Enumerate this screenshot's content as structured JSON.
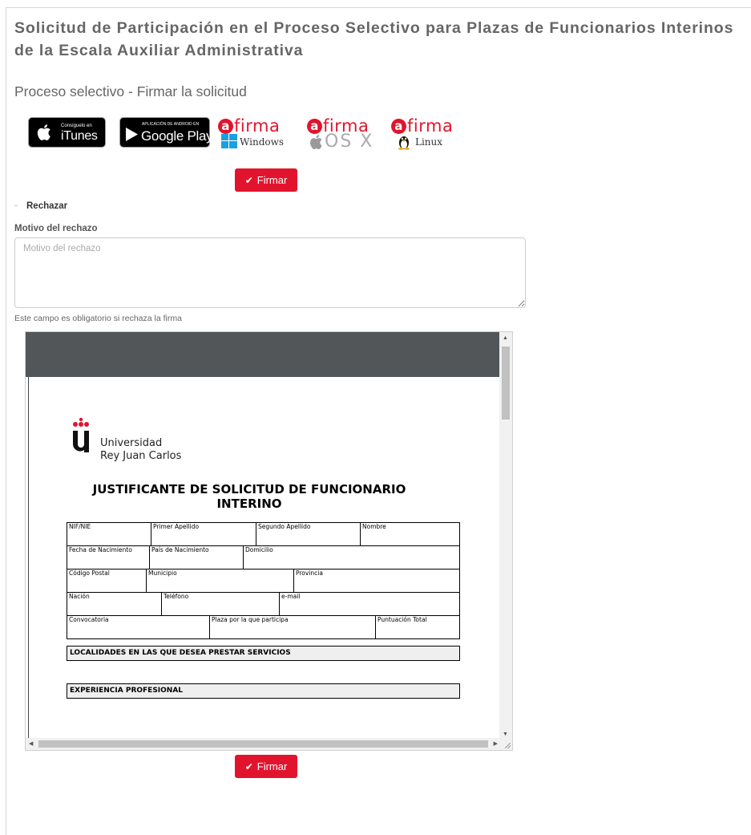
{
  "page": {
    "title": "Solicitud de Participación en el Proceso Selectivo para Plazas de Funcionarios Interinos de la Escala Auxiliar Administrativa",
    "subtitle": "Proceso selectivo - Firmar la solicitud"
  },
  "badges": {
    "itunes": {
      "small": "Consíguelo en",
      "big": "iTunes",
      "icon": "apple-icon"
    },
    "google_play": {
      "small": "APLICACIÓN DE ANDROID EN",
      "big": "Google Play",
      "icon": "play-triangle-icon"
    },
    "afirma": [
      {
        "brand": "firma",
        "platform": "Windows",
        "icon": "windows-icon"
      },
      {
        "brand": "firma",
        "platform": "OS X",
        "icon": "apple-icon"
      },
      {
        "brand": "firma",
        "platform": "Linux",
        "icon": "tux-icon"
      }
    ]
  },
  "actions": {
    "firmar_label": "Firmar",
    "rechazar_label": "Rechazar"
  },
  "reject_form": {
    "label": "Motivo del rechazo",
    "placeholder": "Motivo del rechazo",
    "value": "",
    "hint": "Este campo es obligatorio si rechaza la firma"
  },
  "document": {
    "org_line1": "Universidad",
    "org_line2": "Rey Juan Carlos",
    "title": "JUSTIFICANTE DE SOLICITUD DE FUNCIONARIO INTERINO",
    "rows": [
      [
        "NIF/NIE",
        "Primer Apellido",
        "Segundo Apellido",
        "Nombre"
      ],
      [
        "Fecha de Nacimiento",
        "País de Nacimiento",
        "Domicilio"
      ],
      [
        "Código Postal",
        "Municipio",
        "Provincia"
      ],
      [
        "Nación",
        "Teléfono",
        "e-mail"
      ],
      [
        "Convocatoria",
        "Plaza por la que participa",
        "Puntuación Total"
      ]
    ],
    "section_localidades": "LOCALIDADES EN LAS QUE DESEA PRESTAR SERVICIOS",
    "section_experiencia": "EXPERIENCIA PROFESIONAL"
  },
  "colors": {
    "accent": "#e2142d",
    "viewer_toolbar": "#525659"
  }
}
